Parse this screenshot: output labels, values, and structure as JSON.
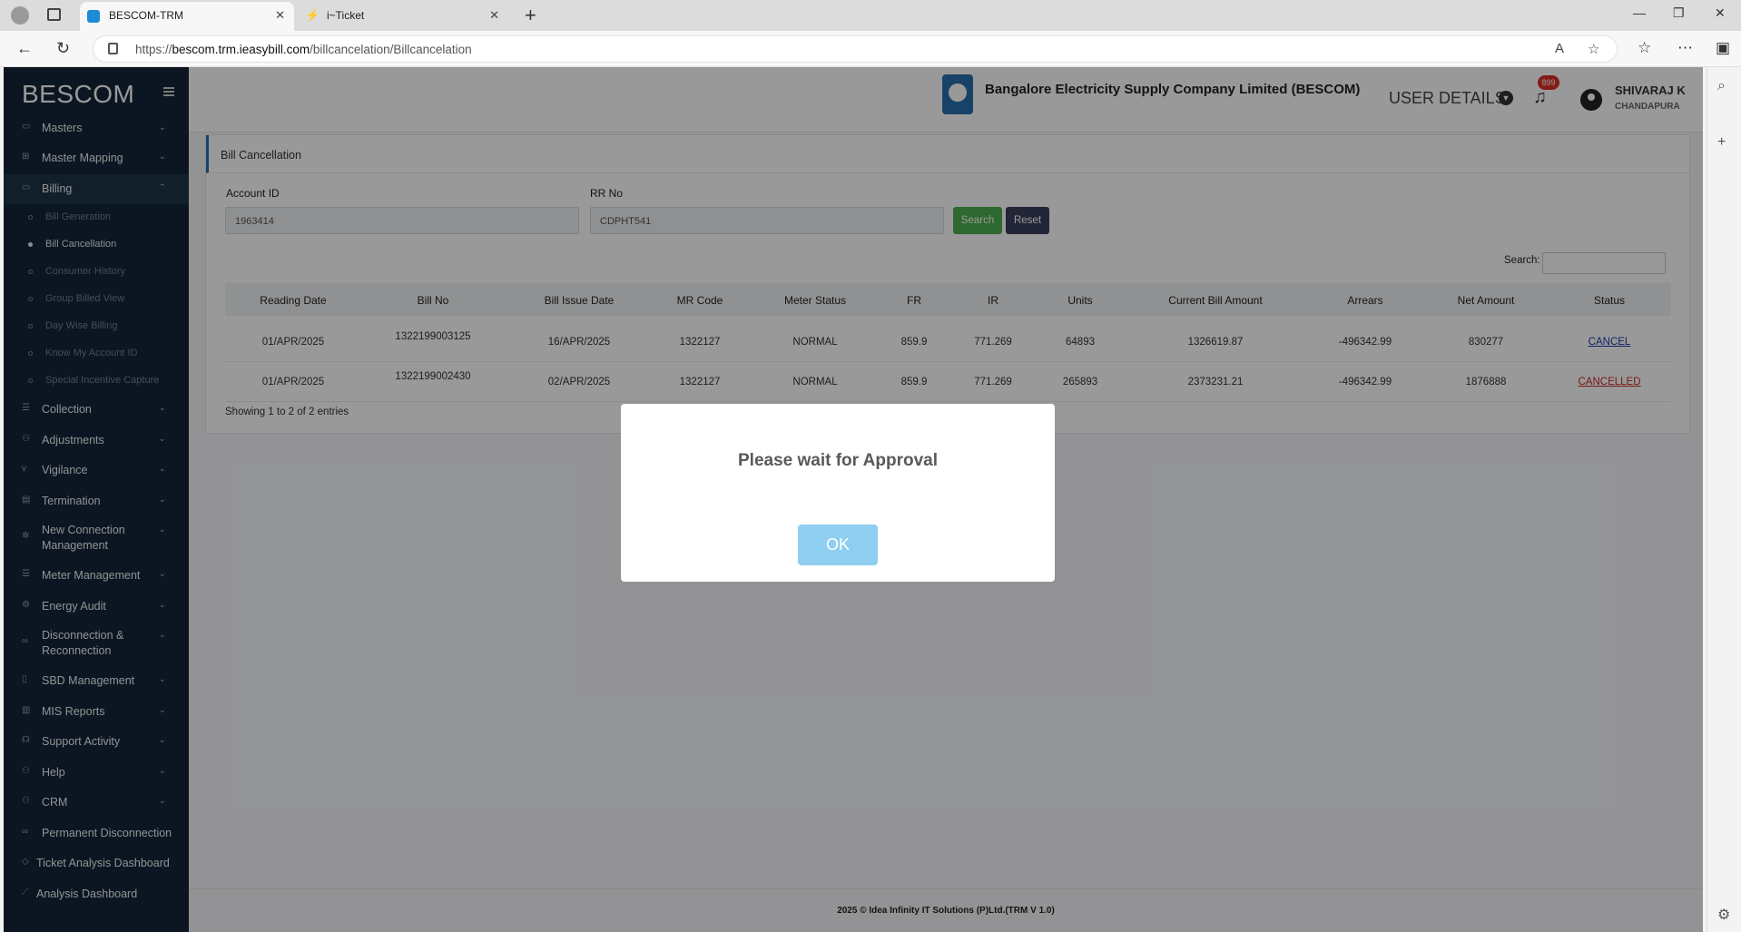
{
  "browser": {
    "tabs": [
      {
        "title": "BESCOM-TRM",
        "active": true
      },
      {
        "title": "i~Ticket",
        "active": false
      }
    ],
    "url_prefix": "https://",
    "url_host": "bescom.trm.ieasybill.com",
    "url_path": "/billcancelation/Billcancelation"
  },
  "sidebar": {
    "brand": "BESCOM",
    "items": [
      {
        "label": "Masters"
      },
      {
        "label": "Master Mapping"
      },
      {
        "label": "Billing"
      },
      {
        "label": "Collection"
      },
      {
        "label": "Adjustments"
      },
      {
        "label": "Vigilance"
      },
      {
        "label": "Termination"
      },
      {
        "label": "New Connection Management"
      },
      {
        "label": "Meter Management"
      },
      {
        "label": "Energy Audit"
      },
      {
        "label": "Disconnection & Reconnection"
      },
      {
        "label": "SBD Management"
      },
      {
        "label": "MIS Reports"
      },
      {
        "label": "Support Activity"
      },
      {
        "label": "Help"
      },
      {
        "label": "CRM"
      },
      {
        "label": "Permanent Disconnection"
      },
      {
        "label": "Ticket Analysis Dashboard"
      },
      {
        "label": "Analysis Dashboard"
      }
    ],
    "billing_sub": [
      {
        "label": "Bill Generation"
      },
      {
        "label": "Bill Cancellation"
      },
      {
        "label": "Consumer History"
      },
      {
        "label": "Group Billed View"
      },
      {
        "label": "Day Wise Billing"
      },
      {
        "label": "Know My Account ID"
      },
      {
        "label": "Special Incentive Capture"
      }
    ]
  },
  "header": {
    "company": "Bangalore Electricity Supply Company Limited (BESCOM)",
    "user_details": "USER DETAILS",
    "notifications": "899",
    "user_name": "SHIVARAJ K",
    "user_location": "CHANDAPURA"
  },
  "page": {
    "title": "Bill Cancellation",
    "account_id_label": "Account ID",
    "account_id_value": "1963414",
    "rr_no_label": "RR No",
    "rr_no_value": "CDPHT541",
    "search_button": "Search",
    "reset_button": "Reset",
    "search_label": "Search:",
    "entries_info": "Showing 1 to 2 of 2 entries"
  },
  "table": {
    "columns": [
      "Reading Date",
      "Bill No",
      "Bill Issue Date",
      "MR Code",
      "Meter Status",
      "FR",
      "IR",
      "Units",
      "Current Bill Amount",
      "Arrears",
      "Net Amount",
      "Status"
    ],
    "rows": [
      [
        "01/APR/2025",
        "1322199003125",
        "16/APR/2025",
        "1322127",
        "NORMAL",
        "859.9",
        "771.269",
        "64893",
        "1326619.87",
        "-496342.99",
        "830277",
        "CANCEL"
      ],
      [
        "01/APR/2025",
        "1322199002430",
        "02/APR/2025",
        "1322127",
        "NORMAL",
        "859.9",
        "771.269",
        "265893",
        "2373231.21",
        "-496342.99",
        "1876888",
        "CANCELLED"
      ]
    ]
  },
  "footer": {
    "text": "2025 © Idea Infinity IT Solutions (P)Ltd.(TRM V 1.0)"
  },
  "modal": {
    "message": "Please wait for Approval",
    "ok_label": "OK"
  }
}
